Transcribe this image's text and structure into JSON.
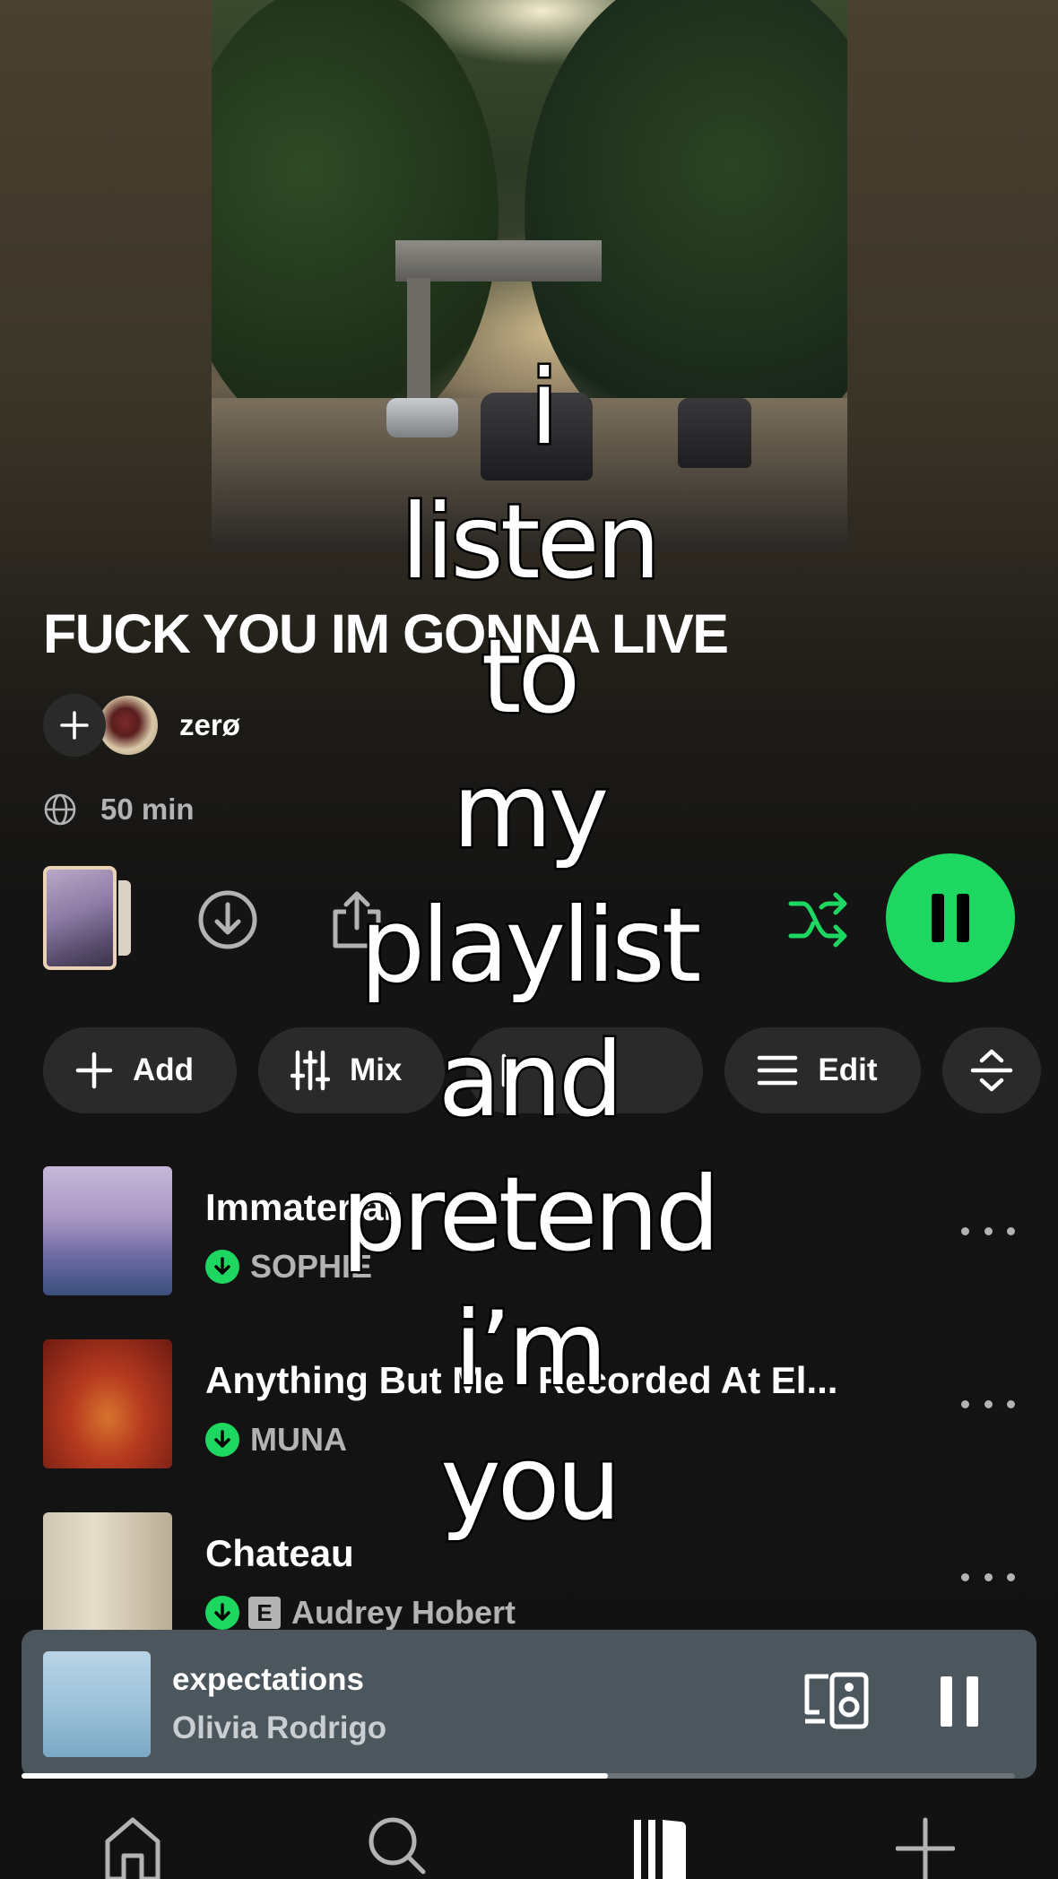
{
  "playlist": {
    "title": "FUCK YOU IM GONNA LIVE",
    "owner": "zerø",
    "duration": "50 min",
    "cover_icon": "playlist-cover-photo"
  },
  "controls": {
    "download_icon": "download-icon",
    "share_icon": "share-icon",
    "shuffle_icon": "smart-shuffle-icon",
    "play_state_icon": "pause-icon",
    "accent_color": "#1ed760"
  },
  "chips": [
    {
      "label": "Add",
      "icon": "plus-icon"
    },
    {
      "label": "Mix",
      "icon": "sliders-icon"
    },
    {
      "label": "",
      "icon": "sort-icon"
    },
    {
      "label": "Edit",
      "icon": "menu-lines-icon"
    }
  ],
  "tracks": [
    {
      "title": "Immaterial",
      "artist": "SOPHIE",
      "downloaded": true,
      "explicit": false
    },
    {
      "title": "Anything But Me - Recorded At El...",
      "artist": "MUNA",
      "downloaded": true,
      "explicit": false
    },
    {
      "title": "Chateau",
      "artist": "Audrey Hobert",
      "downloaded": true,
      "explicit": true,
      "explicit_label": "E"
    }
  ],
  "now_playing": {
    "title": "expectations",
    "artist": "Olivia Rodrigo",
    "progress": 0.59,
    "device_icon": "connect-device-icon",
    "state_icon": "pause-icon"
  },
  "nav": [
    {
      "icon": "home-icon"
    },
    {
      "icon": "search-icon"
    },
    {
      "icon": "library-icon",
      "active": true
    },
    {
      "icon": "create-icon"
    }
  ],
  "overlay_caption": [
    "i",
    "listen",
    "to",
    "my",
    "playlist",
    "and",
    "pretend",
    "i’m",
    "you"
  ]
}
